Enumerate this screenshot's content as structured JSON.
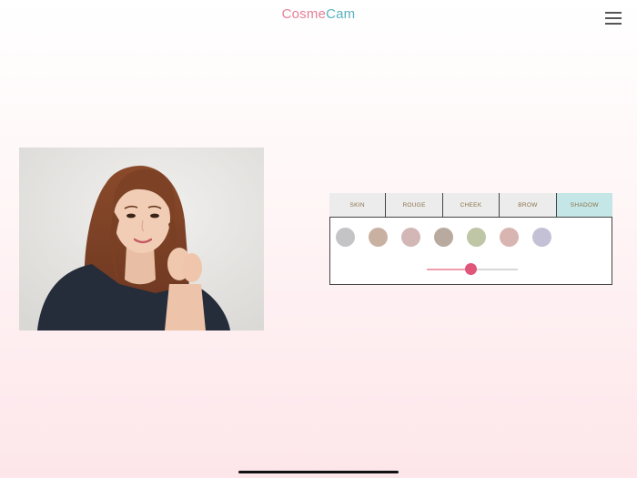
{
  "header": {
    "title_part1": "Cosme",
    "title_part2": "Cam",
    "title_colors": {
      "part1": "#e57f95",
      "part2": "#57b3bf"
    },
    "menu_icon": "hamburger-menu-icon"
  },
  "photo": {
    "subject": "portrait-photo"
  },
  "makeup_panel": {
    "tabs": [
      {
        "label": "SKIN",
        "active": false
      },
      {
        "label": "ROUGE",
        "active": false
      },
      {
        "label": "CHEEK",
        "active": false
      },
      {
        "label": "BROW",
        "active": false
      },
      {
        "label": "SHADOW",
        "active": true
      }
    ],
    "active_tab_color": "#c4e6e7",
    "swatches": [
      {
        "color": "#c4c4c6"
      },
      {
        "color": "#c9b1a2"
      },
      {
        "color": "#d2b7b6"
      },
      {
        "color": "#b8aa9f"
      },
      {
        "color": "#bfc6a6"
      },
      {
        "color": "#d9b5b2"
      },
      {
        "color": "#c4c1d6"
      }
    ],
    "intensity": 0.48,
    "slider_colors": {
      "fill": "#ef9fb0",
      "thumb": "#e0567a",
      "track": "#d8d8d8"
    }
  }
}
